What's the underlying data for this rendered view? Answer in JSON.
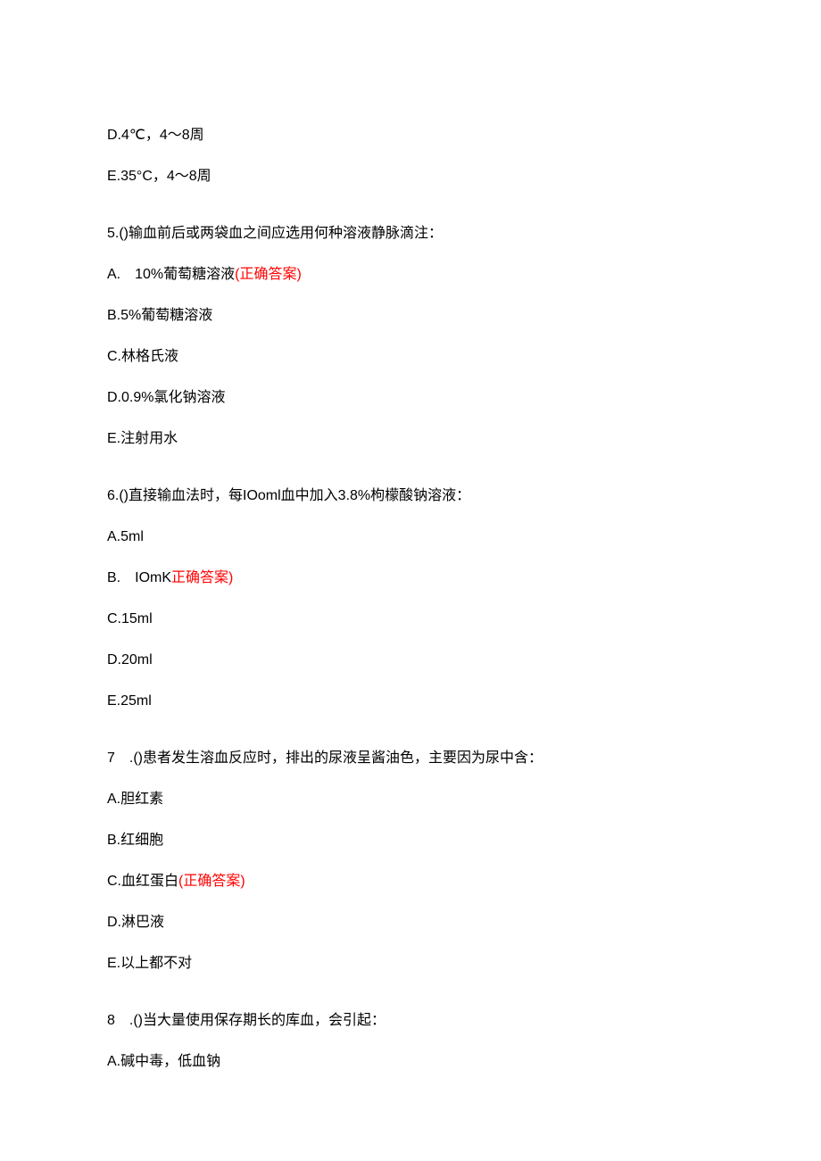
{
  "q4": {
    "optD": "D.4℃，4～8周",
    "optE": "E.35°C，4～8周"
  },
  "q5": {
    "stem": "5.()输血前后或两袋血之间应选用何种溶液静脉滴注：",
    "optA_text": "A.　10%葡萄糖溶液",
    "optA_marker": "(正确答案)",
    "optB": "B.5%葡萄糖溶液",
    "optC": "C.林格氏液",
    "optD": "D.0.9%氯化钠溶液",
    "optE": "E.注射用水"
  },
  "q6": {
    "stem": "6.()直接输血法时，每IOoml血中加入3.8%枸檬酸钠溶液：",
    "optA": "A.5ml",
    "optB_text": "B.　IOmK",
    "optB_marker": "正确答案)",
    "optC": "C.15ml",
    "optD": "D.20ml",
    "optE": "E.25ml"
  },
  "q7": {
    "stem": "7　.()患者发生溶血反应时，排出的尿液呈酱油色，主要因为尿中含：",
    "optA": "A.胆红素",
    "optB": "B.红细胞",
    "optC_text": "C.血红蛋白",
    "optC_marker": "(正确答案)",
    "optD": "D.淋巴液",
    "optE": "E.以上都不对"
  },
  "q8": {
    "stem": "8　.()当大量使用保存期长的库血，会引起：",
    "optA": "A.碱中毒，低血钠"
  }
}
